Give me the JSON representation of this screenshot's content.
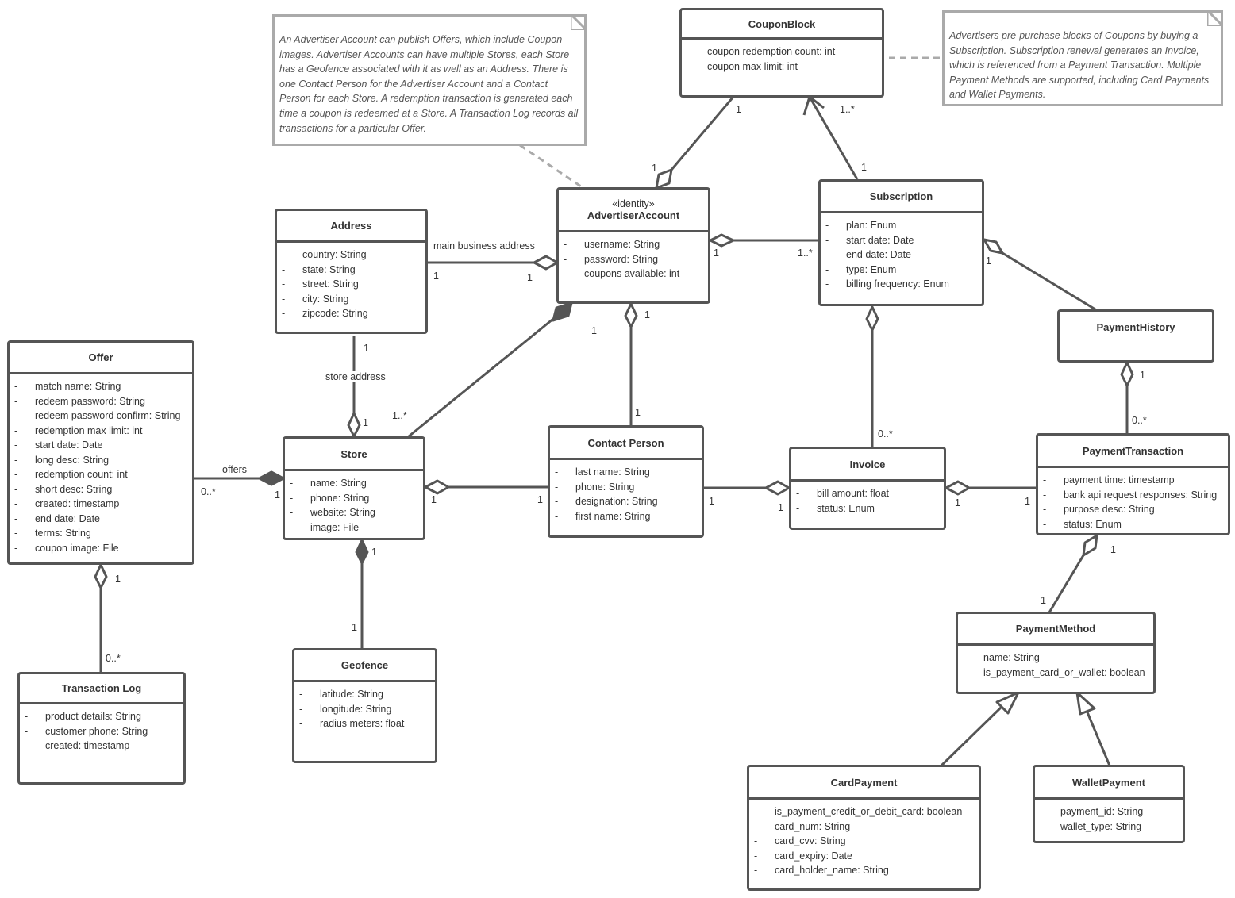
{
  "diagram": {
    "type": "UML class diagram",
    "colors": {
      "line": "#555555",
      "note_border": "#aaaaaa",
      "text": "#333333",
      "note_text": "#555555"
    }
  },
  "notes": [
    {
      "id": "note-advertiser",
      "text": "An Advertiser Account can publish Offers, which include Coupon images.  Advertiser Accounts can have multiple Stores, each Store has a Geofence associated with it as well as an Address.  There is one Contact Person for the Advertiser Account and a Contact Person for each Store.  A redemption transaction is generated each time a coupon is redeemed at a Store.  A Transaction Log records all transactions for a particular Offer."
    },
    {
      "id": "note-subscription",
      "text": "Advertisers pre-purchase blocks of Coupons by buying a Subscription.  Subscription renewal generates an Invoice, which is referenced from a Payment Transaction.  Multiple Payment Methods are supported, including Card Payments and Wallet Payments."
    }
  ],
  "classes": {
    "couponblock": {
      "name": "CouponBlock",
      "attributes": [
        {
          "vis": "-",
          "text": "coupon redemption count: int"
        },
        {
          "vis": "-",
          "text": "coupon max limit: int"
        }
      ]
    },
    "advertiser": {
      "stereotype": "«identity»",
      "name": "AdvertiserAccount",
      "attributes": [
        {
          "vis": "-",
          "text": "username: String"
        },
        {
          "vis": "-",
          "text": "password: String"
        },
        {
          "vis": "-",
          "text": "coupons available: int"
        }
      ]
    },
    "subscription": {
      "name": "Subscription",
      "attributes": [
        {
          "vis": "-",
          "text": "plan: Enum"
        },
        {
          "vis": "-",
          "text": "start date: Date"
        },
        {
          "vis": "-",
          "text": "end date: Date"
        },
        {
          "vis": "-",
          "text": "type: Enum"
        },
        {
          "vis": "-",
          "text": "billing frequency: Enum"
        }
      ]
    },
    "address": {
      "name": "Address",
      "attributes": [
        {
          "vis": "-",
          "text": "country: String"
        },
        {
          "vis": "-",
          "text": "state: String"
        },
        {
          "vis": "-",
          "text": "street: String"
        },
        {
          "vis": "-",
          "text": "city: String"
        },
        {
          "vis": "-",
          "text": "zipcode: String"
        }
      ]
    },
    "paymenthistory": {
      "name": "PaymentHistory",
      "attributes": []
    },
    "offer": {
      "name": "Offer",
      "attributes": [
        {
          "vis": "-",
          "text": "match name: String"
        },
        {
          "vis": "-",
          "text": "redeem password: String"
        },
        {
          "vis": "-",
          "text": "redeem password confirm: String"
        },
        {
          "vis": "-",
          "text": "redemption max limit: int"
        },
        {
          "vis": "-",
          "text": "start date: Date"
        },
        {
          "vis": "-",
          "text": "long desc: String"
        },
        {
          "vis": "-",
          "text": "redemption count: int"
        },
        {
          "vis": "-",
          "text": "short desc: String"
        },
        {
          "vis": "-",
          "text": "created: timestamp"
        },
        {
          "vis": "-",
          "text": "end date: Date"
        },
        {
          "vis": "-",
          "text": "terms: String"
        },
        {
          "vis": "-",
          "text": "coupon image: File"
        }
      ]
    },
    "store": {
      "name": "Store",
      "attributes": [
        {
          "vis": "-",
          "text": "name: String"
        },
        {
          "vis": "-",
          "text": "phone: String"
        },
        {
          "vis": "-",
          "text": "website: String"
        },
        {
          "vis": "-",
          "text": "image: File"
        }
      ]
    },
    "contact": {
      "name": "Contact Person",
      "attributes": [
        {
          "vis": "-",
          "text": "last name: String"
        },
        {
          "vis": "-",
          "text": "phone: String"
        },
        {
          "vis": "-",
          "text": "designation: String"
        },
        {
          "vis": "-",
          "text": "first name: String"
        }
      ]
    },
    "invoice": {
      "name": "Invoice",
      "attributes": [
        {
          "vis": "-",
          "text": "bill amount: float"
        },
        {
          "vis": "-",
          "text": "status: Enum"
        }
      ]
    },
    "paymenttransaction": {
      "name": "PaymentTransaction",
      "attributes": [
        {
          "vis": "-",
          "text": "payment time: timestamp"
        },
        {
          "vis": "-",
          "text": "bank api request responses: String"
        },
        {
          "vis": "-",
          "text": "purpose desc: String"
        },
        {
          "vis": "-",
          "text": "status: Enum"
        }
      ]
    },
    "transactionlog": {
      "name": "Transaction Log",
      "attributes": [
        {
          "vis": "-",
          "text": "product details: String"
        },
        {
          "vis": "-",
          "text": "customer phone: String"
        },
        {
          "vis": "-",
          "text": "created: timestamp"
        }
      ]
    },
    "geofence": {
      "name": "Geofence",
      "attributes": [
        {
          "vis": "-",
          "text": "latitude: String"
        },
        {
          "vis": "-",
          "text": "longitude: String"
        },
        {
          "vis": "-",
          "text": "radius meters: float"
        }
      ]
    },
    "paymentmethod": {
      "name": "PaymentMethod",
      "attributes": [
        {
          "vis": "-",
          "text": "name: String"
        },
        {
          "vis": "-",
          "text": "is_payment_card_or_wallet: boolean"
        }
      ]
    },
    "cardpayment": {
      "name": "CardPayment",
      "attributes": [
        {
          "vis": "-",
          "text": "is_payment_credit_or_debit_card: boolean"
        },
        {
          "vis": "-",
          "text": "card_num: String"
        },
        {
          "vis": "-",
          "text": "card_cvv: String"
        },
        {
          "vis": "-",
          "text": "card_expiry: Date"
        },
        {
          "vis": "-",
          "text": "card_holder_name: String"
        }
      ]
    },
    "walletpayment": {
      "name": "WalletPayment",
      "attributes": [
        {
          "vis": "-",
          "text": "payment_id: String"
        },
        {
          "vis": "-",
          "text": "wallet_type: String"
        }
      ]
    }
  },
  "relationships": [
    {
      "from": "AdvertiserAccount",
      "to": "CouponBlock",
      "kind": "aggregation",
      "mult_from": "1",
      "mult_to": "1"
    },
    {
      "from": "Subscription",
      "to": "CouponBlock",
      "kind": "directed association",
      "mult_from": "1",
      "mult_to": "1..*"
    },
    {
      "from": "AdvertiserAccount",
      "to": "Subscription",
      "kind": "aggregation",
      "mult_from": "1",
      "mult_to": "1..*"
    },
    {
      "from": "AdvertiserAccount",
      "to": "Address",
      "kind": "aggregation",
      "label": "main business address",
      "mult_from": "1",
      "mult_to": "1"
    },
    {
      "from": "AdvertiserAccount",
      "to": "Store",
      "kind": "composition",
      "mult_from": "1",
      "mult_to": "1..*"
    },
    {
      "from": "AdvertiserAccount",
      "to": "Contact Person",
      "kind": "aggregation",
      "mult_from": "1",
      "mult_to": "1"
    },
    {
      "from": "Store",
      "to": "Address",
      "kind": "aggregation",
      "label": "store address",
      "mult_from": "1",
      "mult_to": "1"
    },
    {
      "from": "Store",
      "to": "Offer",
      "kind": "composition",
      "label": "offers",
      "mult_from": "1",
      "mult_to": "0..*"
    },
    {
      "from": "Store",
      "to": "Contact Person",
      "kind": "aggregation",
      "mult_from": "1",
      "mult_to": "1"
    },
    {
      "from": "Store",
      "to": "Geofence",
      "kind": "composition",
      "mult_from": "1",
      "mult_to": "1"
    },
    {
      "from": "Offer",
      "to": "Transaction Log",
      "kind": "aggregation",
      "mult_from": "1",
      "mult_to": "0..*"
    },
    {
      "from": "Subscription",
      "to": "PaymentHistory",
      "kind": "aggregation",
      "mult_from": "1"
    },
    {
      "from": "Subscription",
      "to": "Invoice",
      "kind": "aggregation",
      "mult_to": "0..*"
    },
    {
      "from": "Invoice",
      "to": "Contact Person",
      "kind": "aggregation",
      "mult_from": "1",
      "mult_to": "1"
    },
    {
      "from": "Invoice",
      "to": "PaymentTransaction",
      "kind": "aggregation",
      "mult_from": "1",
      "mult_to": "1"
    },
    {
      "from": "PaymentHistory",
      "to": "PaymentTransaction",
      "kind": "aggregation",
      "mult_from": "1",
      "mult_to": "0..*"
    },
    {
      "from": "PaymentTransaction",
      "to": "PaymentMethod",
      "kind": "aggregation",
      "mult_from": "1",
      "mult_to": "1"
    },
    {
      "from": "CardPayment",
      "to": "PaymentMethod",
      "kind": "generalization"
    },
    {
      "from": "WalletPayment",
      "to": "PaymentMethod",
      "kind": "generalization"
    }
  ],
  "edge_labels": {
    "main_business_address": "main business address",
    "store_address": "store address",
    "offers": "offers"
  },
  "multiplicities": {
    "m1": "1",
    "m_many": "1..*",
    "m_zero_many": "0..*"
  }
}
